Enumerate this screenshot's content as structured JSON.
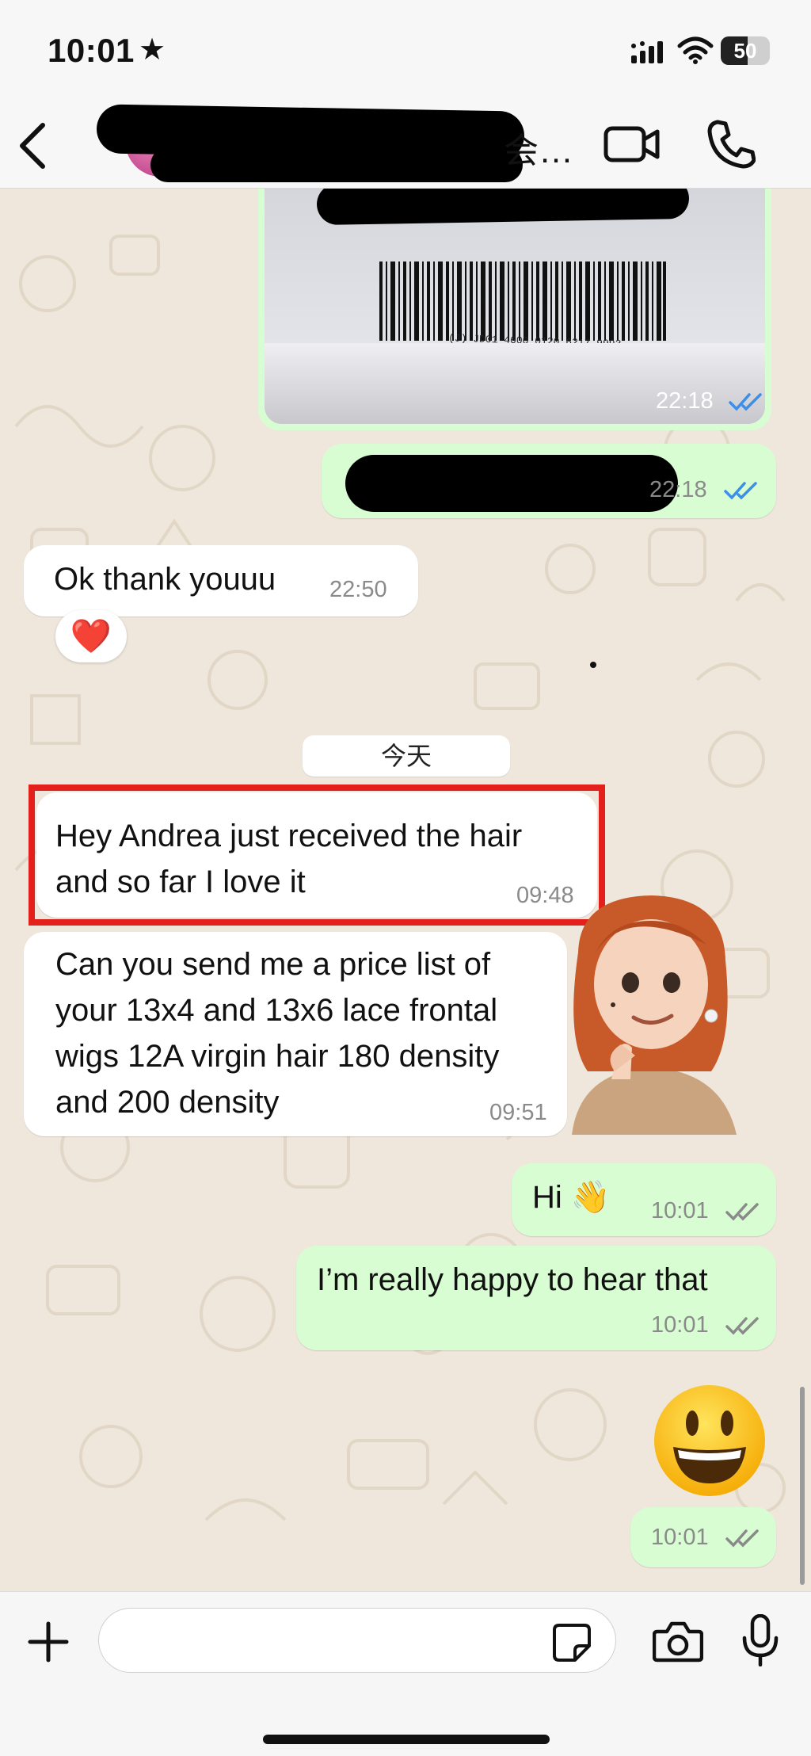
{
  "status_bar": {
    "time": "10:01",
    "star": "★",
    "battery": "50"
  },
  "header": {
    "contact_name_visible": "会…",
    "icons": [
      "back-chevron-icon",
      "video-camera-icon",
      "phone-icon"
    ]
  },
  "image_message": {
    "barcode_number": "(J) JD01 4600 0120 6217 9993",
    "time": "22:18",
    "read": true
  },
  "messages": [
    {
      "id": "out_redacted",
      "direction": "out",
      "text": "",
      "time": "22:18",
      "read": true
    },
    {
      "id": "in_thanks",
      "direction": "in",
      "text": "Ok thank youuu",
      "time": "22:50",
      "reaction": "❤️"
    },
    {
      "id": "in_received",
      "direction": "in",
      "lines": [
        "Hey Andrea just received the hair",
        "and so far I love it"
      ],
      "time": "09:48",
      "highlighted": true
    },
    {
      "id": "in_pricelist",
      "direction": "in",
      "lines": [
        "Can you send me a price list of",
        "your 13x4 and 13x6 lace frontal",
        "wigs 12A virgin hair 180 density",
        "and 200 density"
      ],
      "time": "09:51"
    },
    {
      "id": "out_hi",
      "direction": "out",
      "text": "Hi 👋",
      "time": "10:01",
      "read": true
    },
    {
      "id": "out_happy",
      "direction": "out",
      "text": "I’m really happy to hear that",
      "time": "10:01",
      "read": true
    },
    {
      "id": "out_emoji",
      "direction": "out",
      "text": "😃",
      "time": "10:01",
      "read": true
    }
  ],
  "date_separator": "今天",
  "composer": {
    "value": "",
    "icons": [
      "plus-icon",
      "sticker-icon",
      "camera-icon",
      "microphone-icon"
    ]
  },
  "colors": {
    "outgoing_bubble": "#d9fdd3",
    "incoming_bubble": "#ffffff",
    "wallpaper": "#efe7dc",
    "highlight_border": "#e3201b",
    "read_tick": "#3b8fe8",
    "delivered_tick": "#8a8a8a"
  }
}
